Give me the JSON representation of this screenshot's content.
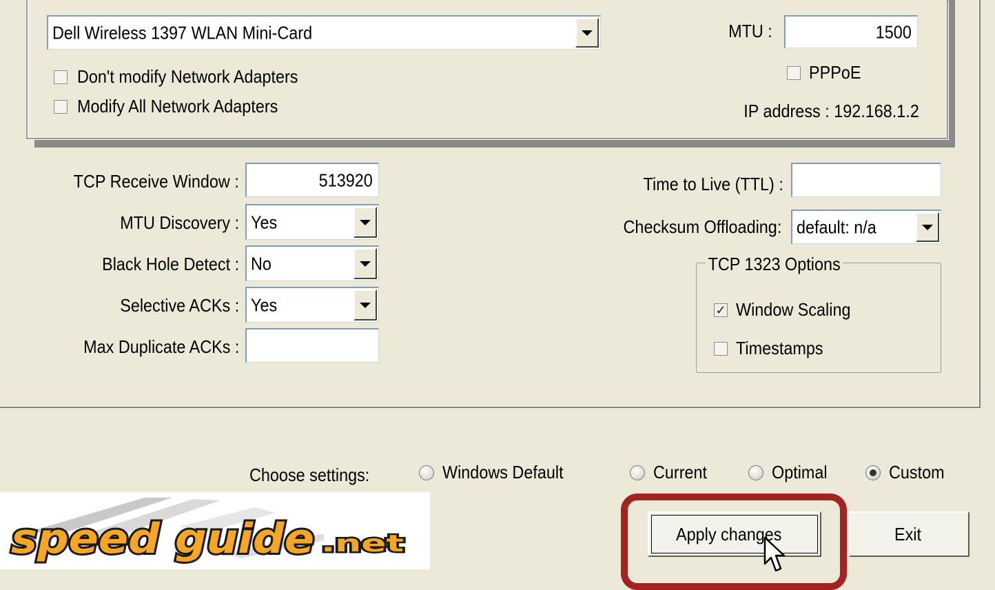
{
  "adapter": {
    "selected": "Dell Wireless 1397 WLAN Mini-Card",
    "dont_modify_label": "Don't modify Network Adapters",
    "modify_all_label": "Modify All Network Adapters",
    "mtu_label": "MTU :",
    "mtu_value": "1500",
    "pppoe_label": "PPPoE",
    "ip_label": "IP address : 192.168.1.2"
  },
  "tcp": {
    "receive_window_label": "TCP Receive Window :",
    "receive_window_value": "513920",
    "mtu_discovery_label": "MTU Discovery :",
    "mtu_discovery_value": "Yes",
    "black_hole_label": "Black Hole Detect :",
    "black_hole_value": "No",
    "selective_acks_label": "Selective ACKs :",
    "selective_acks_value": "Yes",
    "max_dup_acks_label": "Max Duplicate ACKs :",
    "max_dup_acks_value": "",
    "ttl_label": "Time to Live (TTL) :",
    "ttl_value": "",
    "checksum_label": "Checksum Offloading:",
    "checksum_value": "default: n/a"
  },
  "options_1323": {
    "legend": "TCP 1323 Options",
    "window_scaling_label": "Window Scaling",
    "window_scaling_checked": true,
    "timestamps_label": "Timestamps",
    "timestamps_checked": false
  },
  "settings": {
    "label": "Choose settings:",
    "windows_default": "Windows Default",
    "current": "Current",
    "optimal": "Optimal",
    "custom": "Custom",
    "selected": "Custom"
  },
  "buttons": {
    "apply": "Apply changes",
    "exit": "Exit"
  },
  "logo": {
    "text_main": "speed guide",
    "text_suffix": ".net"
  },
  "colors": {
    "background": "#ece9d8",
    "highlight": "#a32323",
    "logo_fill": "#f5a623"
  }
}
